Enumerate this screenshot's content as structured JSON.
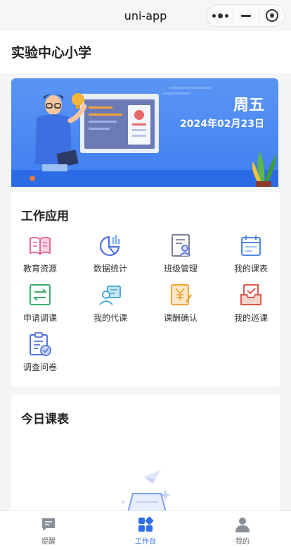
{
  "navbar": {
    "title": "uni-app"
  },
  "header": {
    "school_name": "实验中心小学"
  },
  "banner": {
    "weekday": "周五",
    "date": "2024年02月23日"
  },
  "apps_section": {
    "title": "工作应用",
    "items": [
      {
        "label": "教育资源",
        "icon": "book-icon",
        "color": "#e66a9a"
      },
      {
        "label": "数据统计",
        "icon": "pie-chart-icon",
        "color": "#4f6fe0"
      },
      {
        "label": "班级管理",
        "icon": "class-roster-icon",
        "color": "#7b8294"
      },
      {
        "label": "我的课表",
        "icon": "calendar-icon",
        "color": "#4f86e6"
      },
      {
        "label": "申请调课",
        "icon": "swap-icon",
        "color": "#3fae72"
      },
      {
        "label": "我的代课",
        "icon": "substitute-icon",
        "color": "#3aa3d4"
      },
      {
        "label": "课酬确认",
        "icon": "yen-doc-icon",
        "color": "#f0a33a"
      },
      {
        "label": "我的巡课",
        "icon": "inbox-check-icon",
        "color": "#e0584a"
      },
      {
        "label": "调查问卷",
        "icon": "survey-icon",
        "color": "#5476d8"
      }
    ]
  },
  "today_section": {
    "title": "今日课表"
  },
  "tabbar": {
    "items": [
      {
        "label": "提醒",
        "icon": "message-icon",
        "active": false
      },
      {
        "label": "工作台",
        "icon": "grid-icon",
        "active": true
      },
      {
        "label": "我的",
        "icon": "user-icon",
        "active": false
      }
    ]
  },
  "colors": {
    "accent": "#2f6ee6",
    "banner": "#4a87f2"
  }
}
